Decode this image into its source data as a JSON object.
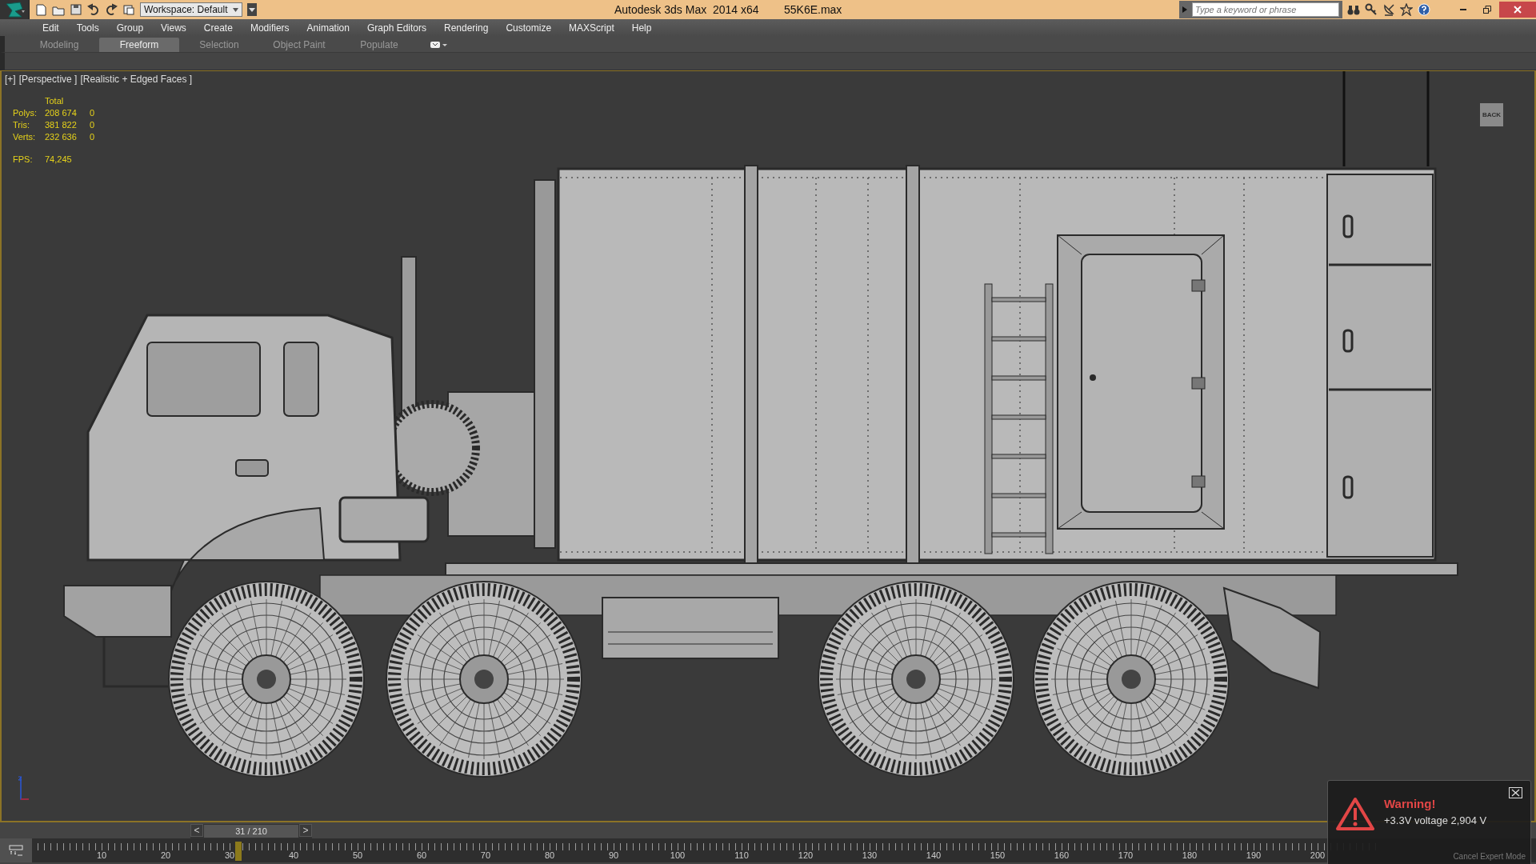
{
  "window": {
    "title": "Autodesk 3ds Max  2014 x64",
    "file": "55K6E.max"
  },
  "workspace": {
    "value": "Workspace: Default"
  },
  "search": {
    "placeholder": "Type a keyword or phrase"
  },
  "menu": [
    "Edit",
    "Tools",
    "Group",
    "Views",
    "Create",
    "Modifiers",
    "Animation",
    "Graph Editors",
    "Rendering",
    "Customize",
    "MAXScript",
    "Help"
  ],
  "ribbon_tabs": [
    {
      "label": "Modeling",
      "selected": false
    },
    {
      "label": "Freeform",
      "selected": true
    },
    {
      "label": "Selection",
      "selected": false
    },
    {
      "label": "Object Paint",
      "selected": false
    },
    {
      "label": "Populate",
      "selected": false
    }
  ],
  "viewport": {
    "labels": [
      "[+]",
      "[Perspective ]",
      "[Realistic + Edged Faces ]"
    ],
    "stats": {
      "header": "Total",
      "rows": [
        {
          "label": "Polys:",
          "total": "208 674",
          "column_3": "0"
        },
        {
          "label": "Tris:",
          "total": "381 822",
          "column_3": "0"
        },
        {
          "label": "Verts:",
          "total": "232 636",
          "column_3": "0"
        }
      ],
      "fps_label": "FPS:",
      "fps": "74,245"
    },
    "viewcube": "BACK"
  },
  "time_slider": {
    "prev": "<",
    "frame": "31 / 210",
    "next": ">",
    "level": 0.1476
  },
  "trackbar": {
    "level": 0.1476,
    "ticks": [
      "10",
      "20",
      "30",
      "40",
      "50",
      "60",
      "70",
      "80",
      "90",
      "100",
      "110",
      "120",
      "130",
      "140",
      "150",
      "160",
      "170",
      "180",
      "190",
      "200"
    ]
  },
  "warning": {
    "title": "Warning!",
    "message": "+3.3V voltage 2,904 V",
    "action": "Cancel Expert Mode"
  }
}
